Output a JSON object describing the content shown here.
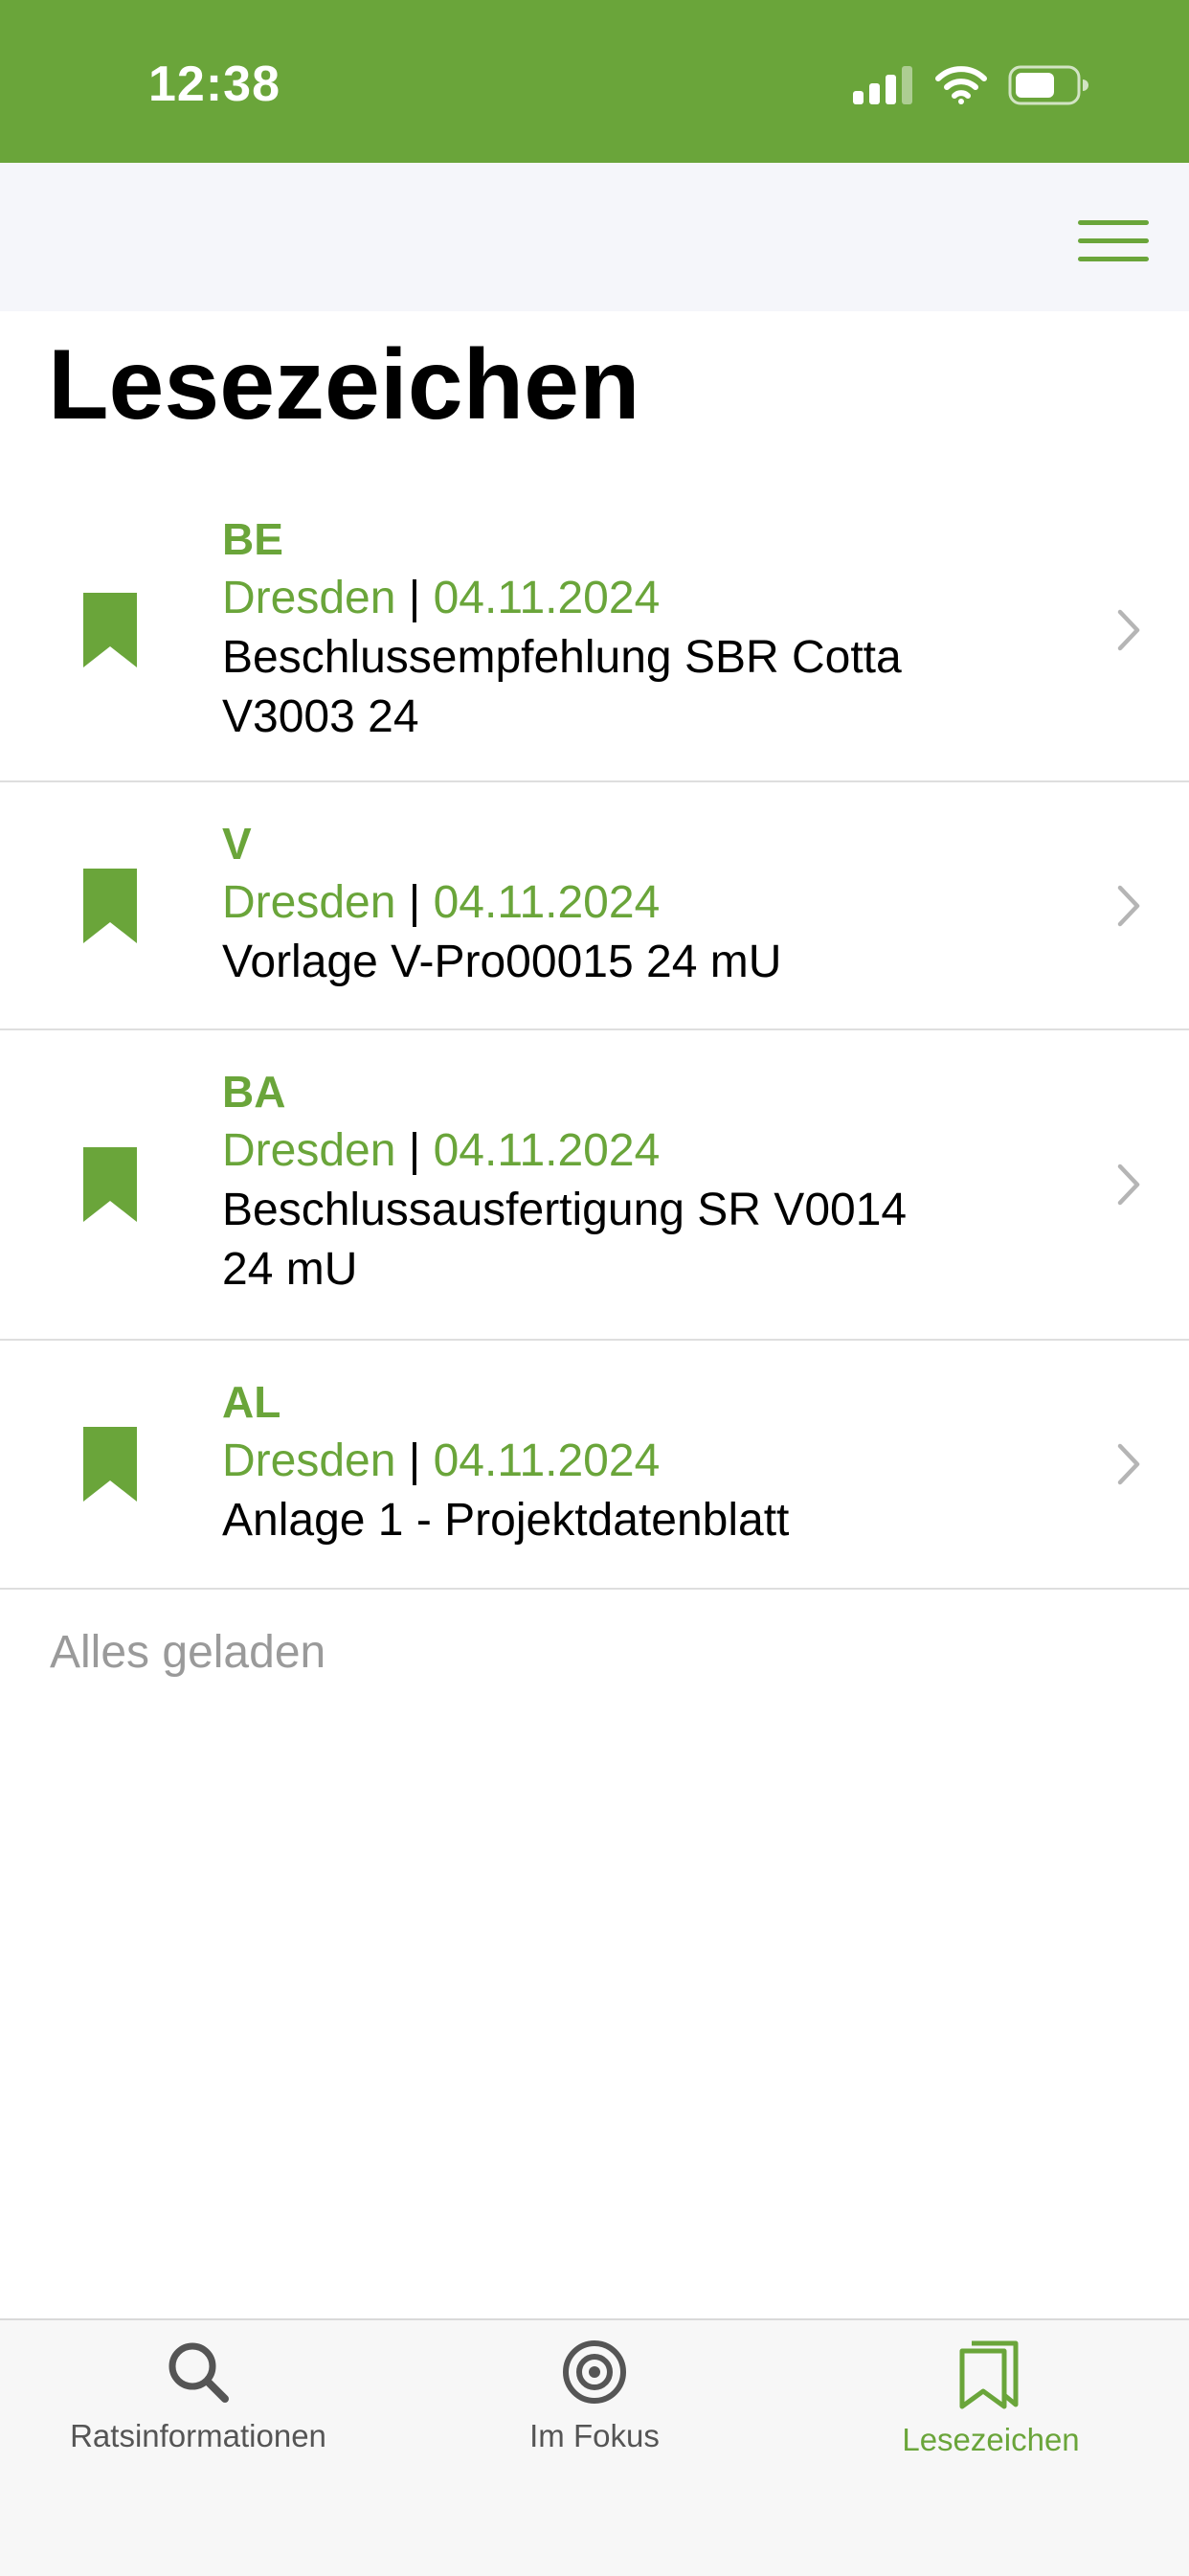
{
  "status_bar": {
    "time": "12:38",
    "icons": [
      "cellular-signal-icon",
      "wifi-icon",
      "battery-icon"
    ]
  },
  "nav": {
    "menu_icon": "hamburger-menu-icon"
  },
  "page": {
    "title": "Lesezeichen"
  },
  "colors": {
    "accent": "#6aa53a",
    "separator": "#dedede",
    "nav_background": "#f5f6fa",
    "muted_text": "#9a9a9a"
  },
  "items": [
    {
      "abbr": "BE",
      "city": "Dresden",
      "separator": "|",
      "date": "04.11.2024",
      "title_lines": [
        "Beschlussempfehlung SBR Cotta",
        "V3003 24"
      ]
    },
    {
      "abbr": "V",
      "city": "Dresden",
      "separator": "|",
      "date": "04.11.2024",
      "title_lines": [
        "Vorlage V-Pro00015 24 mU"
      ]
    },
    {
      "abbr": "BA",
      "city": "Dresden",
      "separator": "|",
      "date": "04.11.2024",
      "title_lines": [
        "Beschlussausfertigung SR V0014",
        "24 mU"
      ]
    },
    {
      "abbr": "AL",
      "city": "Dresden",
      "separator": "|",
      "date": "04.11.2024",
      "title_lines": [
        "Anlage 1 - Projektdatenblatt"
      ]
    }
  ],
  "list_footer": "Alles geladen",
  "tabs": [
    {
      "label": "Ratsinformationen",
      "icon": "search-icon",
      "active": false
    },
    {
      "label": "Im Fokus",
      "icon": "target-icon",
      "active": false
    },
    {
      "label": "Lesezeichen",
      "icon": "bookmarks-icon",
      "active": true
    }
  ]
}
